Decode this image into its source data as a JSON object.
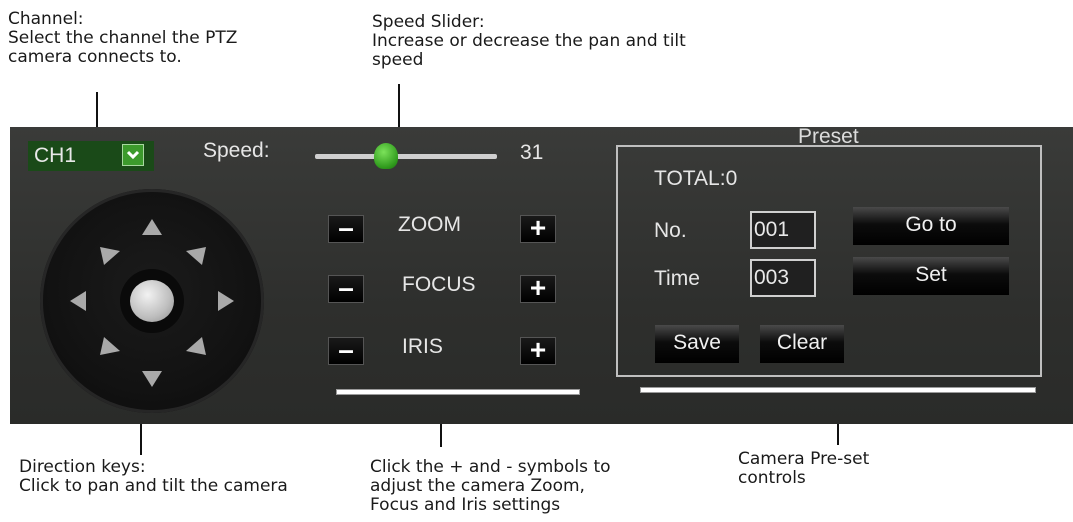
{
  "callouts": {
    "channel": {
      "title": "Channel:",
      "line1": "Select the channel the PTZ",
      "line2": "camera connects to."
    },
    "speed": {
      "title": "Speed Slider:",
      "line1": "Increase or decrease the pan and tilt",
      "line2": "speed"
    },
    "direction": {
      "title": "Direction keys:",
      "line1": "Click to pan and tilt the camera"
    },
    "zoom_focus_iris": {
      "line1": "Click the + and - symbols to",
      "line2": "adjust the camera Zoom,",
      "line3": "Focus and Iris settings"
    },
    "preset": {
      "line1": "Camera Pre-set",
      "line2": "controls"
    }
  },
  "ptz": {
    "channel": "CH1",
    "speed_label": "Speed:",
    "speed_value": "31",
    "speed_fraction": 0.39,
    "zoom_label": "ZOOM",
    "focus_label": "FOCUS",
    "iris_label": "IRIS",
    "minus": "–",
    "plus": "+"
  },
  "preset": {
    "title": "Preset",
    "total": "TOTAL:0",
    "no_label": "No.",
    "no_value": "001",
    "time_label": "Time",
    "time_value": "003",
    "goto_label": "Go to",
    "set_label": "Set",
    "save_label": "Save",
    "clear_label": "Clear"
  },
  "colors": {
    "panel_bg": "#2e2f2d",
    "accent_green": "#3c9a2c",
    "channel_bg": "#1a4a18"
  }
}
